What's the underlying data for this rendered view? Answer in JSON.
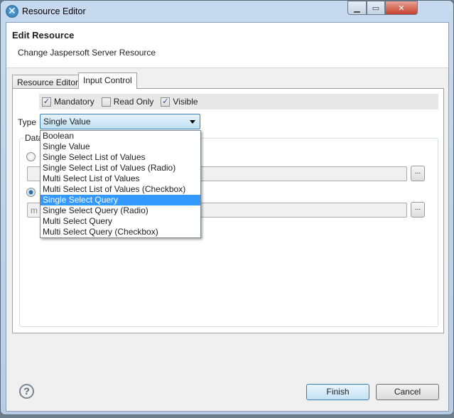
{
  "window": {
    "title": "Resource Editor"
  },
  "header": {
    "title": "Edit Resource",
    "subtitle": "Change Jaspersoft Server Resource"
  },
  "tabs": [
    {
      "label": "Resource Editor",
      "active": false
    },
    {
      "label": "Input Control",
      "active": true
    }
  ],
  "options": {
    "mandatory": {
      "label": "Mandatory",
      "checked": true
    },
    "read_only": {
      "label": "Read Only",
      "checked": false
    },
    "visible": {
      "label": "Visible",
      "checked": true
    }
  },
  "type": {
    "label": "Type",
    "value": "Single Value"
  },
  "dropdown": {
    "items": [
      "Boolean",
      "Single Value",
      "Single Select List of Values",
      "Single Select List of Values (Radio)",
      "Multi Select List of Values",
      "Multi Select List of Values (Checkbox)",
      "Single Select Query",
      "Single Select Query (Radio)",
      "Multi Select Query",
      "Multi Select Query (Checkbox)"
    ],
    "highlighted": "Single Select Query"
  },
  "datasource": {
    "legend": "Data",
    "field2_value_fragment": "m",
    "browse_label": "..."
  },
  "buttons": {
    "finish": "Finish",
    "cancel": "Cancel",
    "help": "?"
  }
}
